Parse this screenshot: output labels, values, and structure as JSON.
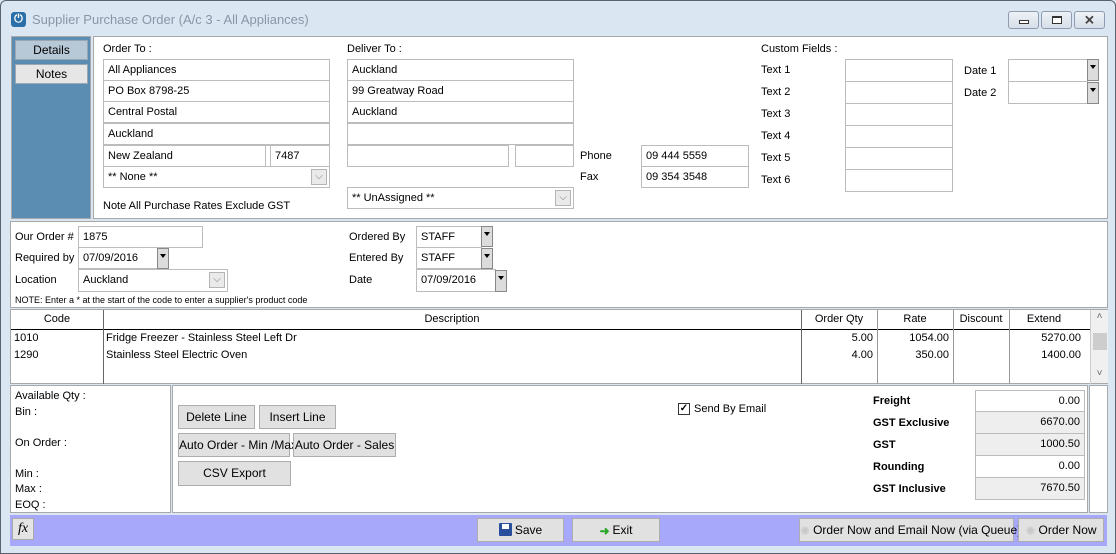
{
  "window": {
    "title": "Supplier Purchase Order (A/c 3 - All Appliances)",
    "app_icon": "power-icon",
    "controls": [
      "minimize",
      "maximize",
      "close"
    ]
  },
  "sidetabs": [
    {
      "label": "Details",
      "active": true
    },
    {
      "label": "Notes",
      "active": false
    }
  ],
  "order_to": {
    "label": "Order To  :",
    "lines": [
      "All Appliances",
      "PO Box 8798-25",
      "Central Postal",
      "Auckland"
    ],
    "country": "New Zealand",
    "postcode": "7487",
    "contact_select": "** None **",
    "note": "Note All Purchase Rates Exclude GST"
  },
  "deliver_to": {
    "label": "Deliver To :",
    "lines": [
      "Auckland",
      "99 Greatway Road",
      "Auckland",
      ""
    ],
    "country": "",
    "postcode": "",
    "assign_select": "** UnAssigned **",
    "phone_label": "Phone",
    "phone": "09 444 5559",
    "fax_label": "Fax",
    "fax": "09 354 3548"
  },
  "custom_fields": {
    "label": "Custom Fields  :",
    "texts": [
      {
        "label": "Text 1",
        "value": ""
      },
      {
        "label": "Text 2",
        "value": ""
      },
      {
        "label": "Text 3",
        "value": ""
      },
      {
        "label": "Text 4",
        "value": ""
      },
      {
        "label": "Text 5",
        "value": ""
      },
      {
        "label": "Text 6",
        "value": ""
      }
    ],
    "dates": [
      {
        "label": "Date 1",
        "value": ""
      },
      {
        "label": "Date 2",
        "value": ""
      }
    ]
  },
  "order_info": {
    "our_order_label": "Our Order #",
    "our_order": "1875",
    "required_by_label": "Required by",
    "required_by": "07/09/2016",
    "location_label": "Location",
    "location": "Auckland",
    "ordered_by_label": "Ordered By",
    "ordered_by": "STAFF",
    "entered_by_label": "Entered By",
    "entered_by": "STAFF",
    "date_label": "Date",
    "date": "07/09/2016",
    "note": "NOTE: Enter a * at the start of the code to enter a supplier's product code"
  },
  "lines_grid": {
    "columns": [
      "Code",
      "Description",
      "Order Qty",
      "Rate",
      "Discount",
      "Extend"
    ],
    "rows": [
      {
        "code": "1010",
        "description": "Fridge Freezer - Stainless Steel Left Dr",
        "qty": "5.00",
        "rate": "1054.00",
        "discount": "",
        "extend": "5270.00"
      },
      {
        "code": "1290",
        "description": "Stainless Steel Electric Oven",
        "qty": "4.00",
        "rate": "350.00",
        "discount": "",
        "extend": "1400.00"
      }
    ]
  },
  "stock_info": {
    "available_qty": "Available Qty :",
    "bin": "Bin :",
    "on_order": "On Order :",
    "min": "Min :",
    "max": "Max :",
    "eoq": "EOQ :"
  },
  "actions": {
    "delete_line": "Delete Line",
    "insert_line": "Insert Line",
    "auto_minmax": "Auto Order - Min /Max",
    "auto_sales": "Auto Order - Sales",
    "csv_export": "CSV Export",
    "send_by_email_label": "Send By Email",
    "send_by_email": true
  },
  "totals": [
    {
      "label": "Freight",
      "value": "0.00",
      "editable": true
    },
    {
      "label": "GST Exclusive",
      "value": "6670.00",
      "editable": false
    },
    {
      "label": "GST",
      "value": "1000.50",
      "editable": false
    },
    {
      "label": "Rounding",
      "value": "0.00",
      "editable": true
    },
    {
      "label": "GST Inclusive",
      "value": "7670.50",
      "editable": false
    }
  ],
  "footer": {
    "fx": "fx",
    "save": "Save",
    "exit": "Exit",
    "order_email": "Order Now and Email Now (via Queue)",
    "order_now": "Order Now"
  },
  "colors": {
    "sidebar": "#5b8db3",
    "footer": "#a8a8fb",
    "window_bg": "#dbe6f3"
  }
}
